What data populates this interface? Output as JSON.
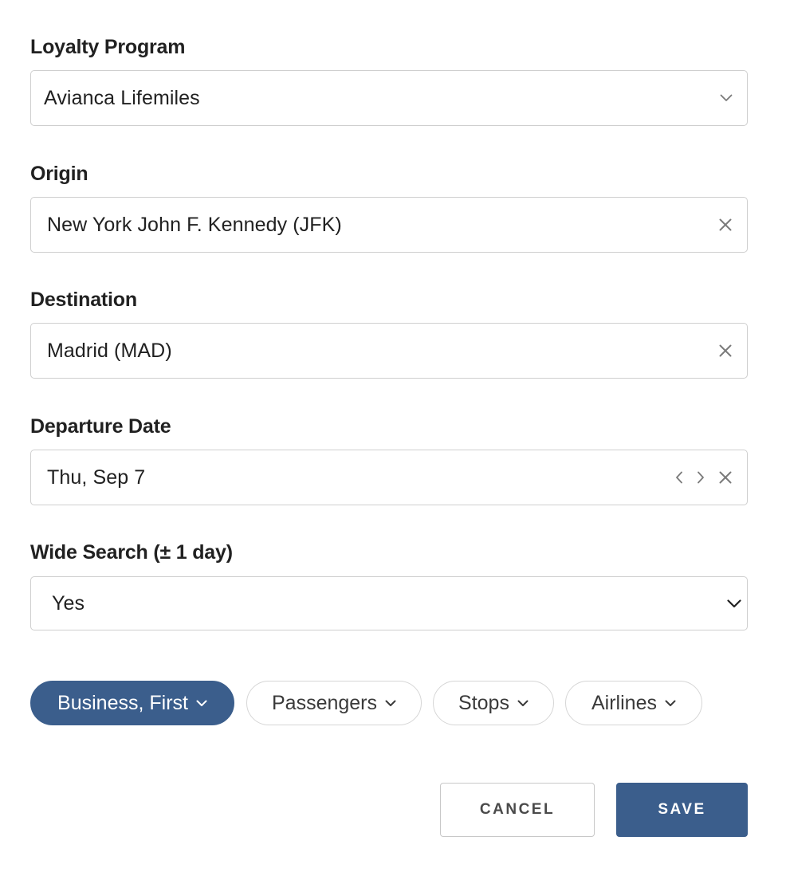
{
  "loyalty": {
    "label": "Loyalty Program",
    "value": "Avianca Lifemiles",
    "icon": "chevron-down-icon"
  },
  "origin": {
    "label": "Origin",
    "value": "New York John F. Kennedy (JFK)",
    "clear_icon": "close-icon"
  },
  "destination": {
    "label": "Destination",
    "value": "Madrid (MAD)",
    "clear_icon": "close-icon"
  },
  "departure": {
    "label": "Departure Date",
    "value": "Thu, Sep 7",
    "prev_icon": "chevron-left-icon",
    "next_icon": "chevron-right-icon",
    "clear_icon": "close-icon"
  },
  "wide_search": {
    "label": "Wide Search (± 1 day)",
    "value": "Yes",
    "icon": "chevron-down-icon"
  },
  "filters": [
    {
      "label": "Business, First",
      "active": true
    },
    {
      "label": "Passengers",
      "active": false
    },
    {
      "label": "Stops",
      "active": false
    },
    {
      "label": "Airlines",
      "active": false
    }
  ],
  "actions": {
    "cancel_label": "CANCEL",
    "save_label": "SAVE"
  },
  "colors": {
    "primary": "#3b5e8c",
    "border": "#cfcfcf",
    "text": "#212121",
    "icon": "#7a7a7a"
  }
}
